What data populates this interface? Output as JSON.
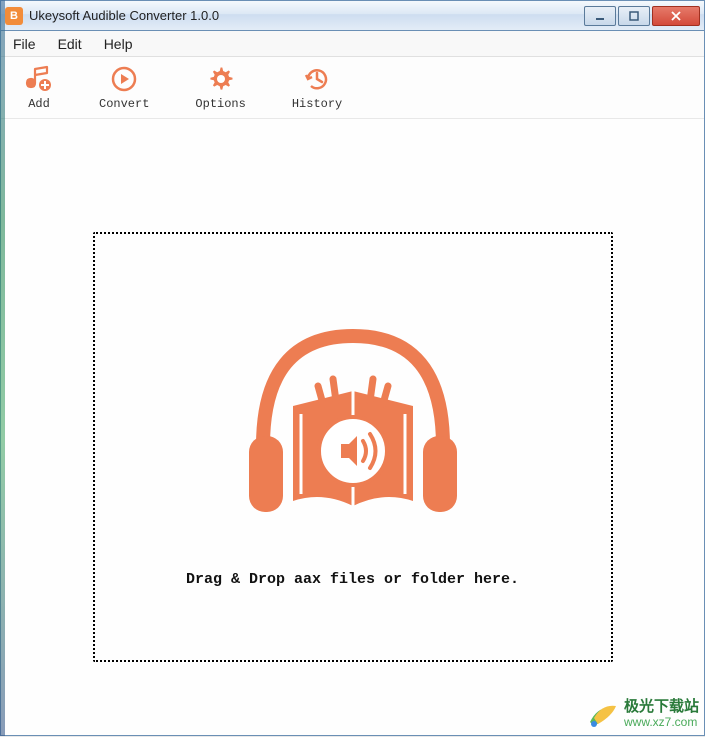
{
  "window": {
    "title": "Ukeysoft Audible Converter 1.0.0"
  },
  "menu": {
    "file": "File",
    "edit": "Edit",
    "help": "Help"
  },
  "toolbar": {
    "add": "Add",
    "convert": "Convert",
    "options": "Options",
    "history": "History"
  },
  "dropzone": {
    "text": "Drag & Drop aax files or folder here."
  },
  "watermark": {
    "cn": "极光下载站",
    "url": "www.xz7.com"
  },
  "colors": {
    "accent": "#ed7d52"
  }
}
